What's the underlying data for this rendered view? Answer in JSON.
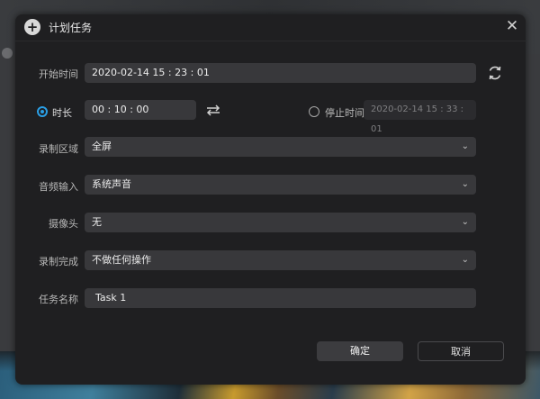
{
  "dialog": {
    "title": "计划任务",
    "close": "✕"
  },
  "start_time": {
    "label": "开始时间",
    "value": "2020-02-14 15 : 23 : 01"
  },
  "duration": {
    "label": "时长",
    "value": "00 : 10 : 00",
    "selected": true
  },
  "stop_time": {
    "label": "停止时间",
    "value": "2020-02-14 15 : 33 : 01",
    "selected": false
  },
  "record_area": {
    "label": "录制区域",
    "value": "全屏"
  },
  "audio_input": {
    "label": "音频输入",
    "value": "系统声音"
  },
  "camera": {
    "label": "摄像头",
    "value": "无"
  },
  "on_complete": {
    "label": "录制完成",
    "value": "不做任何操作"
  },
  "task_name": {
    "label": "任务名称",
    "value": "Task 1"
  },
  "buttons": {
    "confirm": "确定",
    "cancel": "取消"
  },
  "colors": {
    "accent": "#2a9fe6",
    "dialog_bg": "#1f1f21",
    "field_bg": "#38383b"
  }
}
